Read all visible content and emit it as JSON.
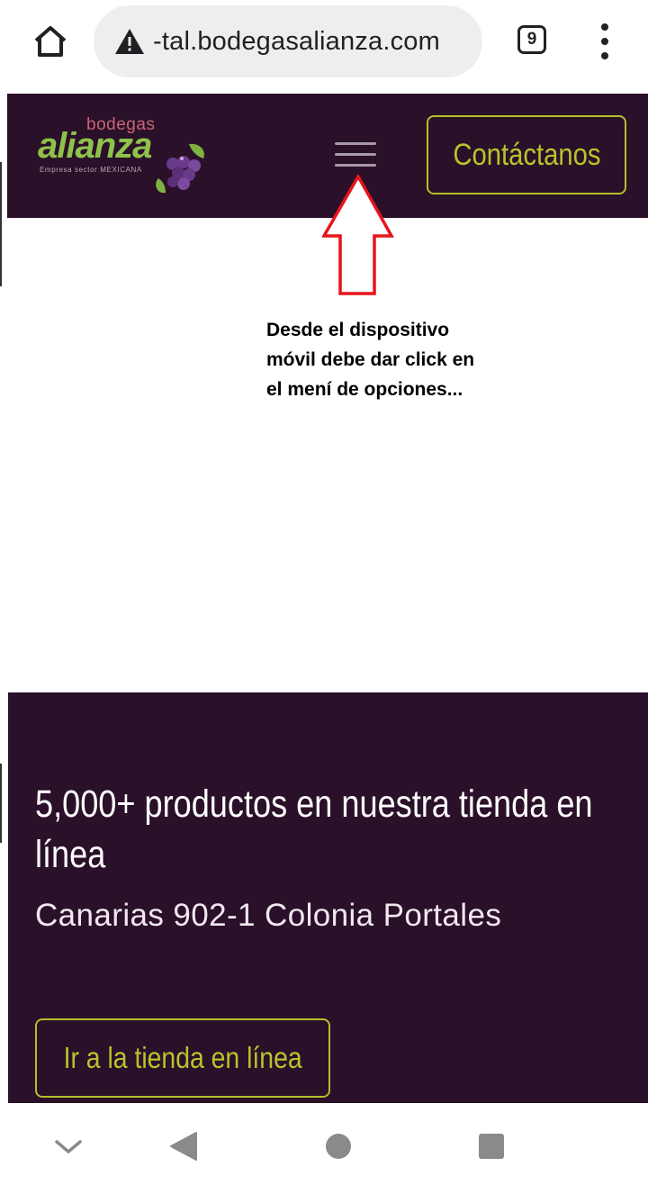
{
  "browser": {
    "url_text": "-tal.bodegasalianza.com",
    "tab_count": "9",
    "icons": [
      "home-icon",
      "warning-icon",
      "tabs-icon",
      "kebab-menu-icon"
    ]
  },
  "header": {
    "logo": {
      "small": "bodegas",
      "big": "alianza",
      "tagline": "Empresa sector MEXICANA"
    },
    "contact_label": "Contáctanos"
  },
  "annotation": {
    "line1": "Desde el dispositivo",
    "line2": "móvil debe dar click en",
    "line3": "el mení de opciones..."
  },
  "hero": {
    "title": "5,000+ productos en nuestra tienda en línea",
    "address": "Canarias 902-1 Colonia Portales",
    "cta_label": "Ir a la tienda en línea"
  },
  "colors": {
    "brand_dark": "#2a1029",
    "accent_lime": "#b8c32b",
    "logo_green": "#8fc24a",
    "annotation_red": "#e8141b"
  }
}
